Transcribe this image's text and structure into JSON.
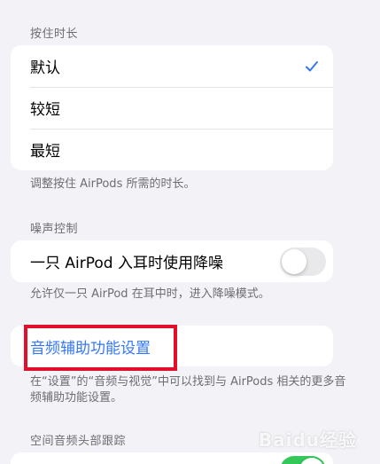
{
  "press_duration": {
    "header": "按住时长",
    "options": [
      {
        "label": "默认",
        "selected": true
      },
      {
        "label": "较短",
        "selected": false
      },
      {
        "label": "最短",
        "selected": false
      }
    ],
    "footer": "调整按住 AirPods 所需的时长。"
  },
  "noise_control": {
    "header": "噪声控制",
    "toggle_label": "一只 AirPod 入耳时使用降噪",
    "toggle_on": false,
    "footer": "允许仅一只 AirPod 在耳中时，进入降噪模式。"
  },
  "accessibility": {
    "link_label": "音频辅助功能设置",
    "footer": "在“设置”的“音频与视觉”中可以找到与 AirPods 相关的更多音频辅助功能设置。"
  },
  "spatial_audio": {
    "header": "空间音频头部跟踪",
    "toggle_on": true
  },
  "colors": {
    "accent": "#3478f6",
    "annotation": "#e0102a",
    "toggle_on": "#34c759"
  },
  "watermark": "Baidu经验"
}
